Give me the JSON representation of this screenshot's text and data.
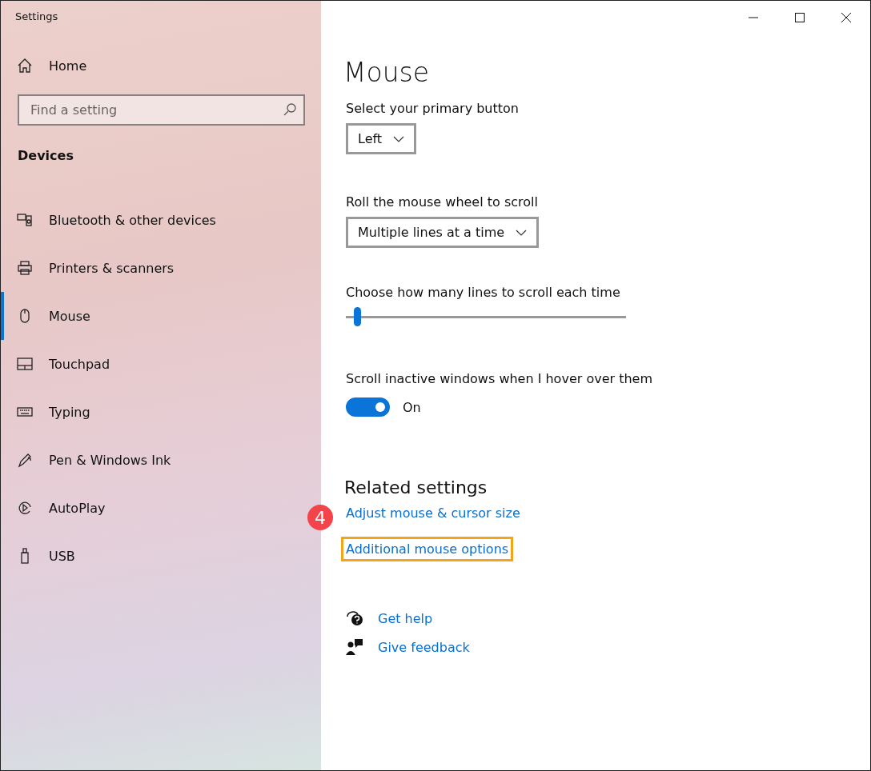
{
  "window": {
    "title": "Settings"
  },
  "sidebar": {
    "home": "Home",
    "search": {
      "placeholder": "Find a setting"
    },
    "section": "Devices",
    "items": [
      {
        "label": "Bluetooth & other devices",
        "kind": "bluetooth",
        "selected": false
      },
      {
        "label": "Printers & scanners",
        "kind": "printer",
        "selected": false
      },
      {
        "label": "Mouse",
        "kind": "mouse",
        "selected": true
      },
      {
        "label": "Touchpad",
        "kind": "touchpad",
        "selected": false
      },
      {
        "label": "Typing",
        "kind": "keyboard",
        "selected": false
      },
      {
        "label": "Pen & Windows Ink",
        "kind": "pen",
        "selected": false
      },
      {
        "label": "AutoPlay",
        "kind": "autoplay",
        "selected": false
      },
      {
        "label": "USB",
        "kind": "usb",
        "selected": false
      }
    ]
  },
  "page": {
    "title": "Mouse",
    "settings": [
      {
        "kind": "dropdown",
        "label": "Select your primary button",
        "value": "Left"
      },
      {
        "kind": "dropdown",
        "label": "Roll the mouse wheel to scroll",
        "value": "Multiple lines at a time"
      },
      {
        "kind": "slider",
        "label": "Choose how many lines to scroll each time",
        "level": 0.03
      },
      {
        "kind": "toggle",
        "label": "Scroll inactive windows when I hover over them",
        "on": true,
        "state_text": "On"
      }
    ],
    "related": {
      "title": "Related settings",
      "links": [
        {
          "label": "Adjust mouse & cursor size",
          "highlighted": false
        },
        {
          "label": "Additional mouse options",
          "highlighted": true,
          "callout": "4"
        }
      ]
    },
    "help": [
      {
        "label": "Get help",
        "kind": "help"
      },
      {
        "label": "Give feedback",
        "kind": "feedback"
      }
    ]
  }
}
